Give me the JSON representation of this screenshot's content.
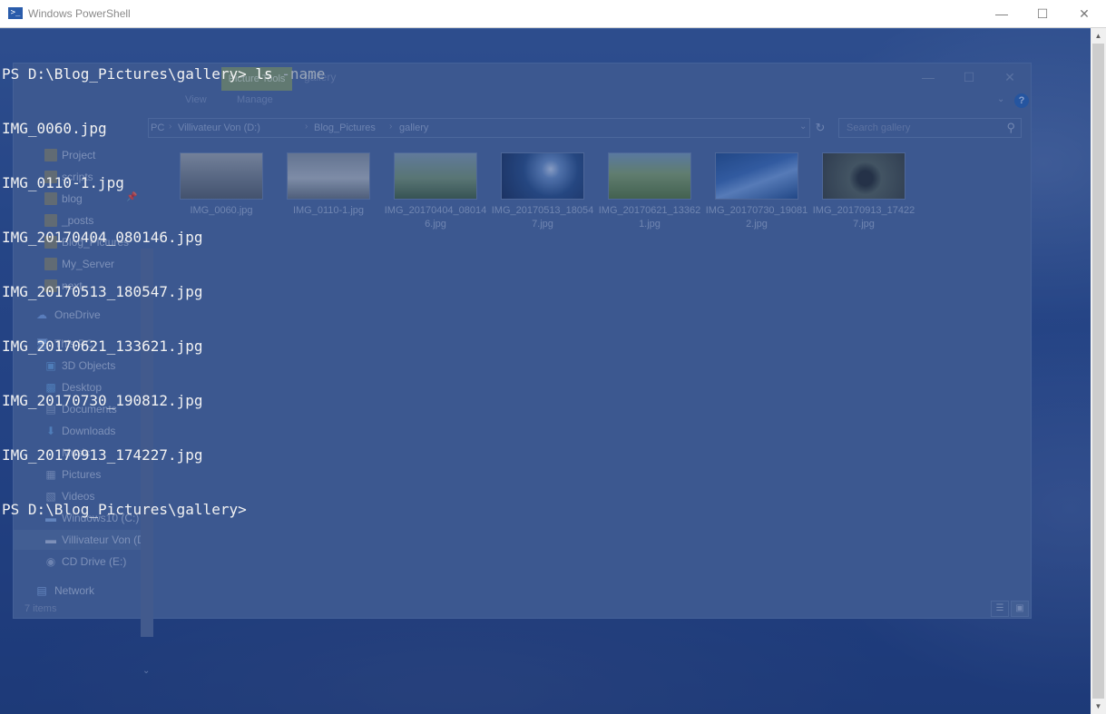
{
  "powershell": {
    "window_title": "Windows PowerShell",
    "controls": {
      "minimize": "—",
      "maximize": "☐",
      "close": "✕"
    },
    "prompt_1": "PS D:\\Blog_Pictures\\gallery> ",
    "command": "ls",
    "param": " -name",
    "output": [
      "IMG_0060.jpg",
      "IMG_0110-1.jpg",
      "IMG_20170404_080146.jpg",
      "IMG_20170513_180547.jpg",
      "IMG_20170621_133621.jpg",
      "IMG_20170730_190812.jpg",
      "IMG_20170913_174227.jpg"
    ],
    "prompt_2": "PS D:\\Blog_Pictures\\gallery>"
  },
  "explorer": {
    "title": "gallery",
    "context_tab": "Picture Tools",
    "ribbon_tabs": {
      "view": "View",
      "manage": "Manage"
    },
    "controls": {
      "minimize": "—",
      "maximize": "☐",
      "close": "✕"
    },
    "address": {
      "root": "PC",
      "drive": "Villivateur Von (D:)",
      "folder": "Blog_Pictures",
      "current": "gallery"
    },
    "search_placeholder": "Search gallery",
    "nav": {
      "quick_access_partial": [
        {
          "label": "Project",
          "icon": "folder"
        },
        {
          "label": "scripts",
          "icon": "folder"
        }
      ],
      "pinned": [
        {
          "label": "blog",
          "icon": "folder"
        },
        {
          "label": "_posts",
          "icon": "folder"
        },
        {
          "label": "Blog_Pictures",
          "icon": "folder"
        },
        {
          "label": "My_Server",
          "icon": "folder"
        },
        {
          "label": "next",
          "icon": "folder"
        }
      ],
      "onedrive": "OneDrive",
      "this_pc": "This PC",
      "pc_items": [
        {
          "label": "3D Objects",
          "icon": "cube-icon"
        },
        {
          "label": "Desktop",
          "icon": "desktop-icon"
        },
        {
          "label": "Documents",
          "icon": "documents-icon"
        },
        {
          "label": "Downloads",
          "icon": "download-icon"
        },
        {
          "label": "Music",
          "icon": "music-icon"
        },
        {
          "label": "Pictures",
          "icon": "pictures-icon"
        },
        {
          "label": "Videos",
          "icon": "videos-icon"
        },
        {
          "label": "Windows10 (C:)",
          "icon": "drive-icon"
        },
        {
          "label": "Villivateur Von (D",
          "icon": "drive-icon"
        },
        {
          "label": "CD Drive (E:)",
          "icon": "cd-drive-icon"
        }
      ],
      "network": "Network"
    },
    "files": [
      {
        "name": "IMG_0060.jpg",
        "colors": [
          "#a8acae",
          "#5b6268"
        ]
      },
      {
        "name": "IMG_0110-1.jpg",
        "colors": [
          "#9fa6ad",
          "#6d757c"
        ]
      },
      {
        "name": "IMG_20170404_080146.jpg",
        "colors": [
          "#6f8b6a",
          "#47633e"
        ]
      },
      {
        "name": "IMG_20170513_180547.jpg",
        "colors": [
          "#2b4f86",
          "#1c2f56"
        ]
      },
      {
        "name": "IMG_20170621_133621.jpg",
        "colors": [
          "#7fa0b8",
          "#5b7a38"
        ]
      },
      {
        "name": "IMG_20170730_190812.jpg",
        "colors": [
          "#3f6fb8",
          "#25508f"
        ]
      },
      {
        "name": "IMG_20170913_174227.jpg",
        "colors": [
          "#5a6456",
          "#3b3f38"
        ]
      }
    ],
    "status": "7 items"
  },
  "colors": {
    "ps_wash": "#1e3a7a",
    "picture_tools_tab": "#8ba06d",
    "help": "#2a66b8"
  }
}
